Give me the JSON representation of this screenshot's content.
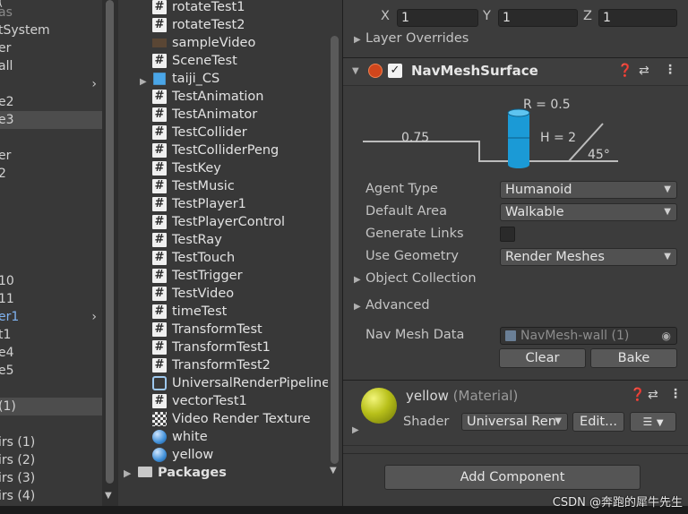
{
  "hierarchy": {
    "rows": [
      "(",
      "as",
      "tSystem",
      "er",
      "all",
      "e2",
      "e3",
      "er",
      "2",
      "10",
      "11",
      "er1",
      "t1",
      "e4",
      "e5",
      "(1)",
      "irs (1)",
      "irs (2)",
      "irs (3)",
      "irs (4)"
    ]
  },
  "project": {
    "items": [
      {
        "label": "rotateTest1",
        "icon": "csharp-script-icon"
      },
      {
        "label": "rotateTest2",
        "icon": "csharp-script-icon"
      },
      {
        "label": "sampleVideo",
        "icon": "video-clip-icon"
      },
      {
        "label": "SceneTest",
        "icon": "csharp-script-icon"
      },
      {
        "label": "taiji_CS",
        "icon": "prefab-icon"
      },
      {
        "label": "TestAnimation",
        "icon": "csharp-script-icon"
      },
      {
        "label": "TestAnimator",
        "icon": "csharp-script-icon"
      },
      {
        "label": "TestCollider",
        "icon": "csharp-script-icon"
      },
      {
        "label": "TestColliderPeng",
        "icon": "csharp-script-icon"
      },
      {
        "label": "TestKey",
        "icon": "csharp-script-icon"
      },
      {
        "label": "TestMusic",
        "icon": "csharp-script-icon"
      },
      {
        "label": "TestPlayer1",
        "icon": "csharp-script-icon"
      },
      {
        "label": "TestPlayerControl",
        "icon": "csharp-script-icon"
      },
      {
        "label": "TestRay",
        "icon": "csharp-script-icon"
      },
      {
        "label": "TestTouch",
        "icon": "csharp-script-icon"
      },
      {
        "label": "TestTrigger",
        "icon": "csharp-script-icon"
      },
      {
        "label": "TestVideo",
        "icon": "csharp-script-icon"
      },
      {
        "label": "timeTest",
        "icon": "csharp-script-icon"
      },
      {
        "label": "TransformTest",
        "icon": "csharp-script-icon"
      },
      {
        "label": "TransformTest1",
        "icon": "csharp-script-icon"
      },
      {
        "label": "TransformTest2",
        "icon": "csharp-script-icon"
      },
      {
        "label": "UniversalRenderPipeline",
        "icon": "render-pipeline-asset-icon"
      },
      {
        "label": "vectorTest1",
        "icon": "csharp-script-icon"
      },
      {
        "label": "Video Render Texture",
        "icon": "render-texture-icon"
      },
      {
        "label": "white",
        "icon": "material-icon"
      },
      {
        "label": "yellow",
        "icon": "material-icon"
      }
    ],
    "packages_label": "Packages"
  },
  "inspector": {
    "scale": {
      "x_label": "X",
      "x_value": "1",
      "y_label": "Y",
      "y_value": "1",
      "z_label": "Z",
      "z_value": "1"
    },
    "layer_overrides": "Layer Overrides",
    "navmesh": {
      "title": "NavMeshSurface",
      "diagram": {
        "radius": "R = 0.5",
        "height": "H = 2",
        "step": "0.75",
        "slope": "45°"
      },
      "agent_type_label": "Agent Type",
      "agent_type_value": "Humanoid",
      "default_area_label": "Default Area",
      "default_area_value": "Walkable",
      "generate_links_label": "Generate Links",
      "use_geometry_label": "Use Geometry",
      "use_geometry_value": "Render Meshes",
      "object_collection_label": "Object Collection",
      "advanced_label": "Advanced",
      "nav_mesh_data_label": "Nav Mesh Data",
      "nav_mesh_data_value": "NavMesh-wall (1)",
      "clear_label": "Clear",
      "bake_label": "Bake"
    },
    "material": {
      "name": "yellow",
      "suffix": " (Material)",
      "shader_label": "Shader",
      "shader_value": "Universal Ren",
      "edit_label": "Edit...",
      "ball_color": "#b8c01a"
    },
    "add_component_label": "Add Component"
  },
  "watermark": "CSDN @奔跑的犀牛先生",
  "colors": {
    "cylinder": "#1b9ad6",
    "panel": "#3c3c3c",
    "text": "#d2d2d2"
  }
}
